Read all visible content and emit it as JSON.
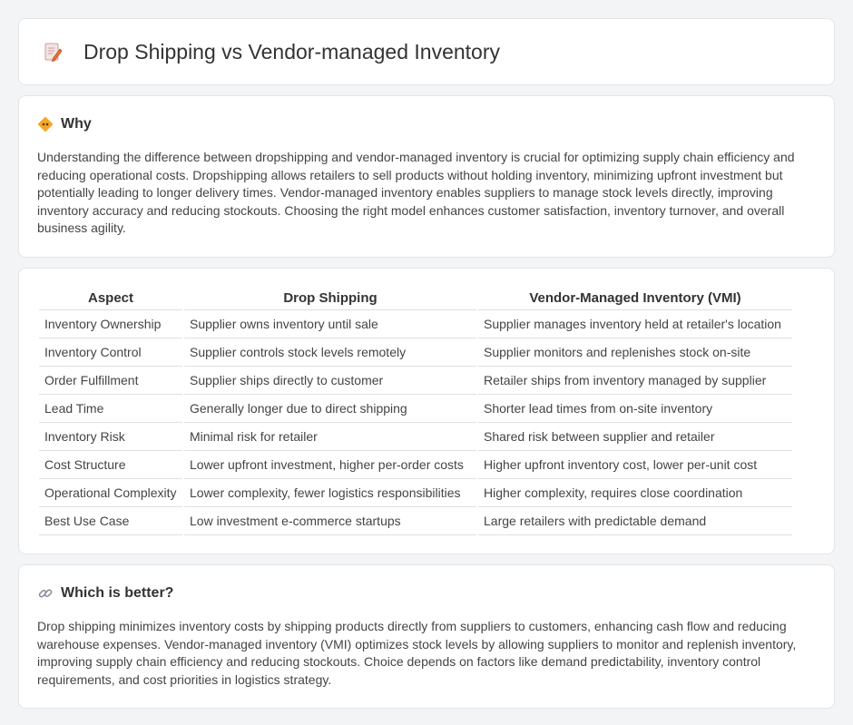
{
  "header": {
    "title": "Drop Shipping vs Vendor-managed Inventory",
    "icon": "memo-pencil-icon"
  },
  "why": {
    "title": "Why",
    "icon": "diamond-sign-icon",
    "text": "Understanding the difference between dropshipping and vendor-managed inventory is crucial for optimizing supply chain efficiency and reducing operational costs. Dropshipping allows retailers to sell products without holding inventory, minimizing upfront investment but potentially leading to longer delivery times. Vendor-managed inventory enables suppliers to manage stock levels directly, improving inventory accuracy and reducing stockouts. Choosing the right model enhances customer satisfaction, inventory turnover, and overall business agility."
  },
  "table": {
    "headers": [
      "Aspect",
      "Drop Shipping",
      "Vendor-Managed Inventory (VMI)"
    ],
    "rows": [
      [
        "Inventory Ownership",
        "Supplier owns inventory until sale",
        "Supplier manages inventory held at retailer's location"
      ],
      [
        "Inventory Control",
        "Supplier controls stock levels remotely",
        "Supplier monitors and replenishes stock on-site"
      ],
      [
        "Order Fulfillment",
        "Supplier ships directly to customer",
        "Retailer ships from inventory managed by supplier"
      ],
      [
        "Lead Time",
        "Generally longer due to direct shipping",
        "Shorter lead times from on-site inventory"
      ],
      [
        "Inventory Risk",
        "Minimal risk for retailer",
        "Shared risk between supplier and retailer"
      ],
      [
        "Cost Structure",
        "Lower upfront investment, higher per-order costs",
        "Higher upfront inventory cost, lower per-unit cost"
      ],
      [
        "Operational Complexity",
        "Lower complexity, fewer logistics responsibilities",
        "Higher complexity, requires close coordination"
      ],
      [
        "Best Use Case",
        "Low investment e-commerce startups",
        "Large retailers with predictable demand"
      ]
    ]
  },
  "better": {
    "title": "Which is better?",
    "icon": "link-icon",
    "text": "Drop shipping minimizes inventory costs by shipping products directly from suppliers to customers, enhancing cash flow and reducing warehouse expenses. Vendor-managed inventory (VMI) optimizes stock levels by allowing suppliers to monitor and replenish inventory, improving supply chain efficiency and reducing stockouts. Choice depends on factors like demand predictability, inventory control requirements, and cost priorities in logistics strategy."
  }
}
